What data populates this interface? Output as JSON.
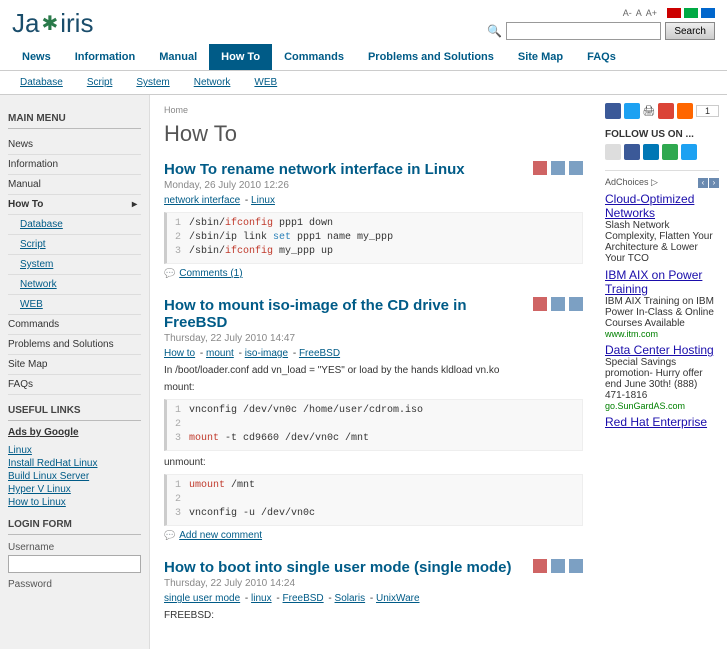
{
  "logo": {
    "pre": "Ja",
    "post": "iris"
  },
  "search": {
    "button": "Search"
  },
  "font_controls": [
    "A-",
    "A",
    "A+"
  ],
  "mainnav": [
    "News",
    "Information",
    "Manual",
    "How To",
    "Commands",
    "Problems and Solutions",
    "Site Map",
    "FAQs"
  ],
  "mainnav_active": "How To",
  "subnav": [
    "Database",
    "Script",
    "System",
    "Network",
    "WEB"
  ],
  "sidebar": {
    "main_menu_title": "MAIN MENU",
    "menu": [
      "News",
      "Information",
      "Manual"
    ],
    "menu_parent": "How To",
    "menu_sub": [
      "Database",
      "Script",
      "System",
      "Network",
      "WEB"
    ],
    "menu_after": [
      "Commands",
      "Problems and Solutions",
      "Site Map",
      "FAQs"
    ],
    "useful_title": "USEFUL LINKS",
    "ads_by": "Ads by Google",
    "ads_links": [
      "Linux",
      "Install RedHat Linux",
      "Build Linux Server",
      "Hyper V Linux",
      "How to Linux"
    ],
    "login_title": "LOGIN FORM",
    "username_label": "Username",
    "password_label": "Password"
  },
  "breadcrumb": "Home",
  "page_title": "How To",
  "articles": [
    {
      "title": "How To rename network interface in Linux",
      "date": "Monday, 26 July 2010 12:26",
      "tags": [
        "network interface",
        "Linux"
      ],
      "code": [
        {
          "n": "1",
          "html": "/sbin/<span class='cmd'>ifconfig</span> ppp1 down"
        },
        {
          "n": "2",
          "html": "/sbin/ip link <span class='kw'>set</span> ppp1 name my_ppp"
        },
        {
          "n": "3",
          "html": "/sbin/<span class='cmd'>ifconfig</span> my_ppp up"
        }
      ],
      "comments": "Comments (1)"
    },
    {
      "title": "How to mount iso-image of the CD drive in FreeBSD",
      "date": "Thursday, 22 July 2010 14:47",
      "tags": [
        "How to",
        "mount",
        "iso-image",
        "FreeBSD"
      ],
      "body1": "In /boot/loader.conf add vn_load = \"YES\" or load by the hands kldload vn.ko",
      "label_mount": "mount:",
      "code": [
        {
          "n": "1",
          "html": "vnconfig /dev/vn0c /home/user/cdrom.iso"
        },
        {
          "n": "2",
          "html": ""
        },
        {
          "n": "3",
          "html": "<span class='cmd'>mount</span> -t cd9660 /dev/vn0c /mnt"
        }
      ],
      "label_unmount": "unmount:",
      "code2": [
        {
          "n": "1",
          "html": "<span class='cmd'>umount</span> /mnt"
        },
        {
          "n": "2",
          "html": ""
        },
        {
          "n": "3",
          "html": "vnconfig -u /dev/vn0c"
        }
      ],
      "comments": "Add new comment"
    },
    {
      "title": "How to boot into single user mode (single mode)",
      "date": "Thursday, 22 July 2010 14:24",
      "tags": [
        "single user mode",
        "linux",
        "FreeBSD",
        "Solaris",
        "UnixWare"
      ],
      "body1": "FREEBSD:"
    }
  ],
  "right": {
    "share_count": "1",
    "follow_title": "FOLLOW US ON ...",
    "adchoices": "AdChoices",
    "ads": [
      {
        "title": "Cloud-Optimized Networks",
        "text": "Slash Network Complexity, Flatten Your Architecture & Lower Your TCO",
        "url": ""
      },
      {
        "title": "IBM AIX on Power Training",
        "text": "IBM AIX Training on IBM Power In-Class & Online Courses Available",
        "url": "www.itm.com"
      },
      {
        "title": "Data Center Hosting",
        "text": "Special Savings promotion- Hurry offer end June 30th! (888) 471-1816",
        "url": "go.SunGardAS.com"
      },
      {
        "title": "Red Hat Enterprise",
        "text": "",
        "url": ""
      }
    ]
  }
}
